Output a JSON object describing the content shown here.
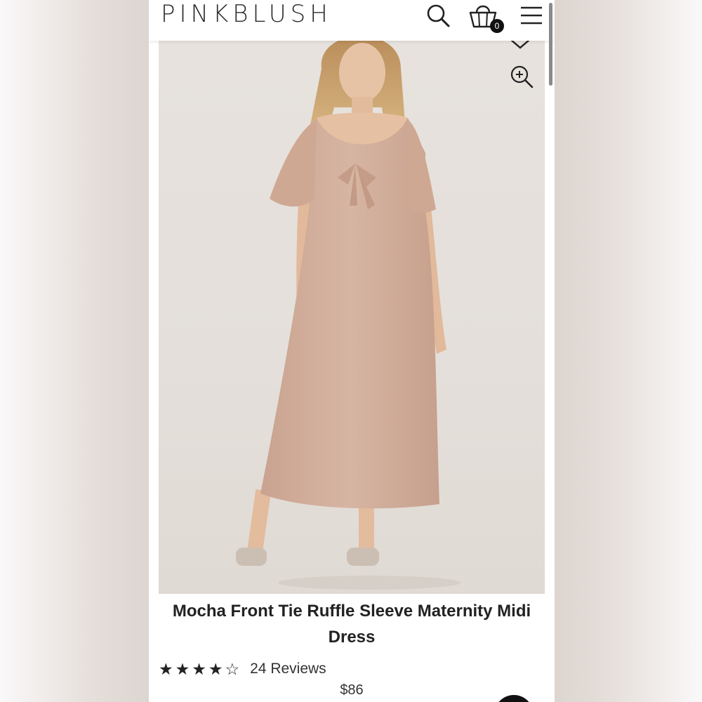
{
  "header": {
    "logo": "PINKBLUSH",
    "cart_count": "0",
    "icons": [
      "search-icon",
      "shopping-bag-icon",
      "menu-icon"
    ]
  },
  "image_actions": {
    "icons": [
      "heart-icon",
      "zoom-in-icon"
    ]
  },
  "product": {
    "title": "Mocha Front Tie Ruffle Sleeve Maternity Midi Dress",
    "rating": 4,
    "rating_max": 5,
    "reviews_label": "24 Reviews",
    "price": "$86"
  },
  "colors": {
    "dress": "#cfab98",
    "backdrop": "#e5e0db",
    "text": "#222222"
  }
}
